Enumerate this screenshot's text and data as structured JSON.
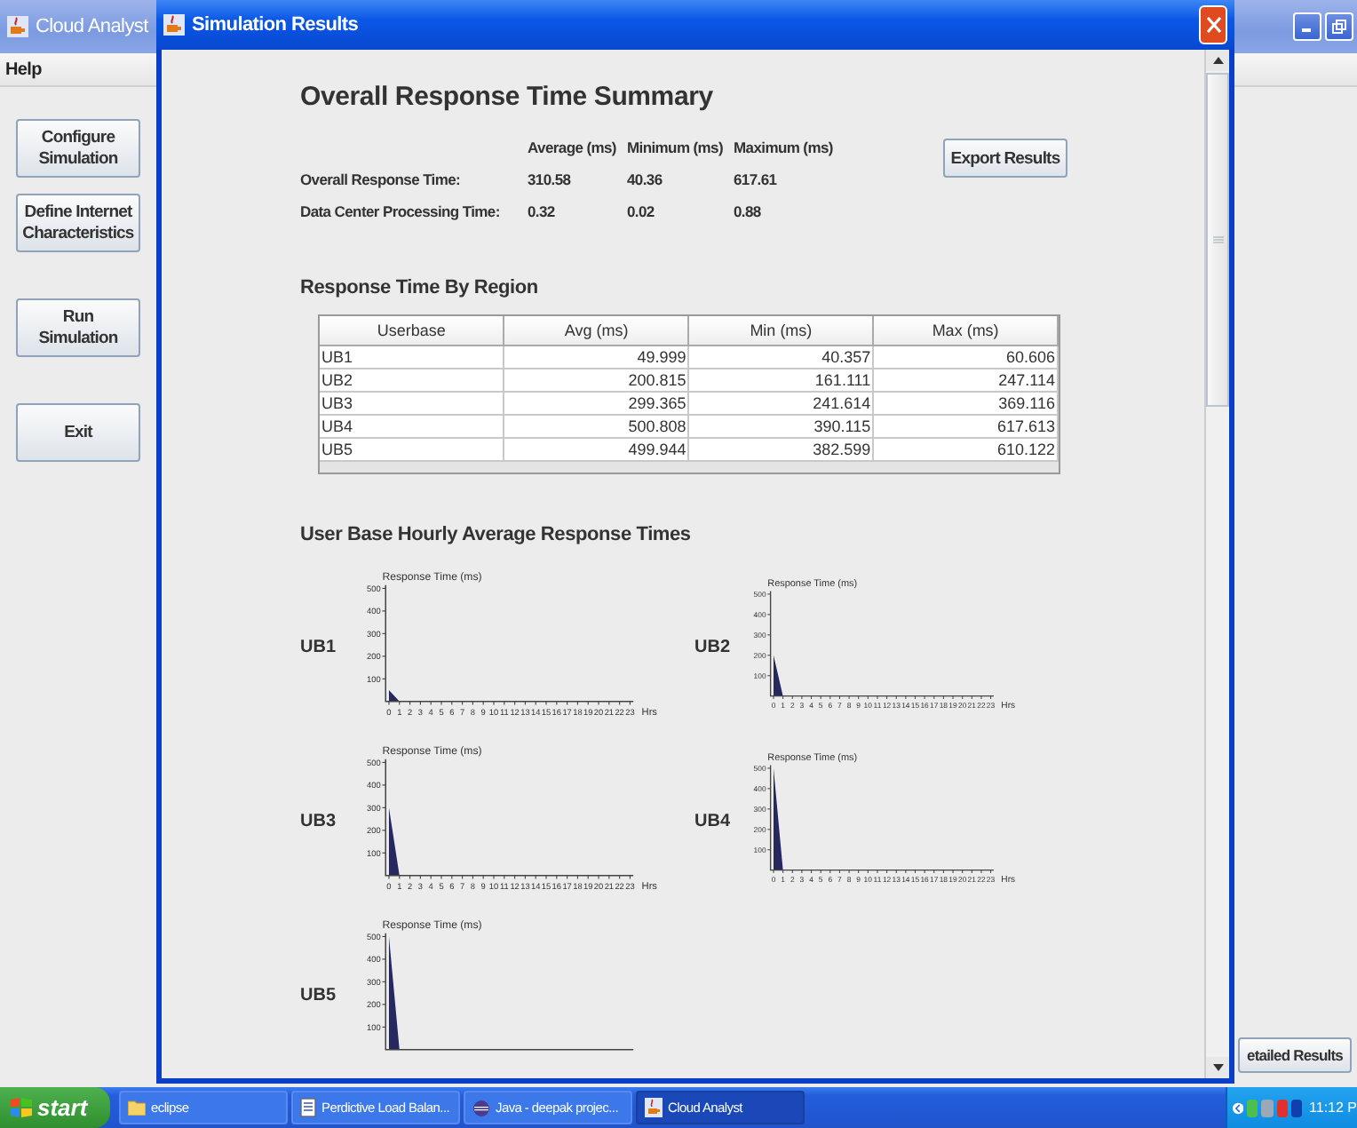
{
  "background_window": {
    "title": "Cloud Analyst",
    "menu": [
      "Help"
    ],
    "buttons": [
      "Configure Simulation",
      "Define Internet Characteristics",
      "Run Simulation",
      "Exit"
    ],
    "bottom_button": "etailed Results"
  },
  "results_window": {
    "title": "Simulation Results",
    "summary": {
      "title": "Overall Response Time Summary",
      "columns": [
        "Average (ms)",
        "Minimum (ms)",
        "Maximum (ms)"
      ],
      "rows": [
        {
          "label": "Overall Response Time:",
          "values": [
            "310.58",
            "40.36",
            "617.61"
          ]
        },
        {
          "label": "Data Center Processing Time:",
          "values": [
            "0.32",
            "0.02",
            "0.88"
          ]
        }
      ],
      "export_button": "Export Results"
    },
    "region_table": {
      "title": "Response Time By Region",
      "columns": [
        "Userbase",
        "Avg (ms)",
        "Min (ms)",
        "Max (ms)"
      ],
      "rows": [
        [
          "UB1",
          "49.999",
          "40.357",
          "60.606"
        ],
        [
          "UB2",
          "200.815",
          "161.111",
          "247.114"
        ],
        [
          "UB3",
          "299.365",
          "241.614",
          "369.116"
        ],
        [
          "UB4",
          "500.808",
          "390.115",
          "617.613"
        ],
        [
          "UB5",
          "499.944",
          "382.599",
          "610.122"
        ]
      ]
    },
    "hourly": {
      "title": "User Base Hourly Average Response Times",
      "charts": [
        {
          "label": "UB1",
          "chart_data": {
            "type": "area",
            "xlim": [
              0,
              23
            ],
            "ylabel": "Response Time (ms)",
            "xlabel": "Hrs",
            "x": [
              0,
              1,
              2,
              3,
              4,
              5,
              6,
              7,
              8,
              9,
              10,
              11,
              12,
              13,
              14,
              15,
              16,
              17,
              18,
              19,
              20,
              21,
              22,
              23
            ],
            "values": [
              50,
              0,
              0,
              0,
              0,
              0,
              0,
              0,
              0,
              0,
              0,
              0,
              0,
              0,
              0,
              0,
              0,
              0,
              0,
              0,
              0,
              0,
              0,
              0
            ],
            "ylim": [
              0,
              500
            ],
            "yticks": [
              100,
              200,
              300,
              400,
              500
            ],
            "xticks": [
              0,
              1,
              2,
              3,
              4,
              5,
              6,
              7,
              8,
              9,
              10,
              11,
              12,
              13,
              14,
              15,
              16,
              17,
              18,
              19,
              20,
              21,
              22,
              23
            ]
          }
        },
        {
          "label": "UB2",
          "chart_data": {
            "type": "area",
            "xlim": [
              0,
              23
            ],
            "ylabel": "Response Time (ms)",
            "xlabel": "Hrs",
            "x": [
              0,
              1,
              2,
              3,
              4,
              5,
              6,
              7,
              8,
              9,
              10,
              11,
              12,
              13,
              14,
              15,
              16,
              17,
              18,
              19,
              20,
              21,
              22,
              23
            ],
            "values": [
              200,
              0,
              0,
              0,
              0,
              0,
              0,
              0,
              0,
              0,
              0,
              0,
              0,
              0,
              0,
              0,
              0,
              0,
              0,
              0,
              0,
              0,
              0,
              0
            ],
            "ylim": [
              0,
              500
            ],
            "yticks": [
              100,
              200,
              300,
              400,
              500
            ],
            "xticks": [
              0,
              1,
              2,
              3,
              4,
              5,
              6,
              7,
              8,
              9,
              10,
              11,
              12,
              13,
              14,
              15,
              16,
              17,
              18,
              19,
              20,
              21,
              22,
              23
            ]
          }
        },
        {
          "label": "UB3",
          "chart_data": {
            "type": "area",
            "xlim": [
              0,
              23
            ],
            "ylabel": "Response Time (ms)",
            "xlabel": "Hrs",
            "x": [
              0,
              1,
              2,
              3,
              4,
              5,
              6,
              7,
              8,
              9,
              10,
              11,
              12,
              13,
              14,
              15,
              16,
              17,
              18,
              19,
              20,
              21,
              22,
              23
            ],
            "values": [
              300,
              0,
              0,
              0,
              0,
              0,
              0,
              0,
              0,
              0,
              0,
              0,
              0,
              0,
              0,
              0,
              0,
              0,
              0,
              0,
              0,
              0,
              0,
              0
            ],
            "ylim": [
              0,
              500
            ],
            "yticks": [
              100,
              200,
              300,
              400,
              500
            ],
            "xticks": [
              0,
              1,
              2,
              3,
              4,
              5,
              6,
              7,
              8,
              9,
              10,
              11,
              12,
              13,
              14,
              15,
              16,
              17,
              18,
              19,
              20,
              21,
              22,
              23
            ]
          }
        },
        {
          "label": "UB4",
          "chart_data": {
            "type": "area",
            "xlim": [
              0,
              23
            ],
            "ylabel": "Response Time (ms)",
            "xlabel": "Hrs",
            "x": [
              0,
              1,
              2,
              3,
              4,
              5,
              6,
              7,
              8,
              9,
              10,
              11,
              12,
              13,
              14,
              15,
              16,
              17,
              18,
              19,
              20,
              21,
              22,
              23
            ],
            "values": [
              500,
              0,
              0,
              0,
              0,
              0,
              0,
              0,
              0,
              0,
              0,
              0,
              0,
              0,
              0,
              0,
              0,
              0,
              0,
              0,
              0,
              0,
              0,
              0
            ],
            "ylim": [
              0,
              500
            ],
            "yticks": [
              100,
              200,
              300,
              400,
              500
            ],
            "xticks": [
              0,
              1,
              2,
              3,
              4,
              5,
              6,
              7,
              8,
              9,
              10,
              11,
              12,
              13,
              14,
              15,
              16,
              17,
              18,
              19,
              20,
              21,
              22,
              23
            ]
          }
        },
        {
          "label": "UB5",
          "chart_data": {
            "type": "area",
            "ylabel": "Response Time (ms)",
            "values": [
              500,
              0,
              0,
              0,
              0,
              0,
              0,
              0,
              0,
              0,
              0,
              0,
              0,
              0,
              0,
              0,
              0,
              0,
              0,
              0,
              0,
              0,
              0,
              0
            ],
            "ylim": [
              0,
              500
            ],
            "yticks": [
              100,
              200,
              300,
              400,
              500
            ]
          }
        }
      ]
    }
  },
  "taskbar": {
    "start": "start",
    "items": [
      {
        "label": "eclipse",
        "kind": "folder",
        "selected": false
      },
      {
        "label": "Perdictive Load Balan...",
        "kind": "document",
        "selected": false
      },
      {
        "label": "Java - deepak projec...",
        "kind": "eclipse",
        "selected": false
      },
      {
        "label": "Cloud Analyst",
        "kind": "java",
        "selected": true
      }
    ],
    "clock": "11:12 P"
  }
}
